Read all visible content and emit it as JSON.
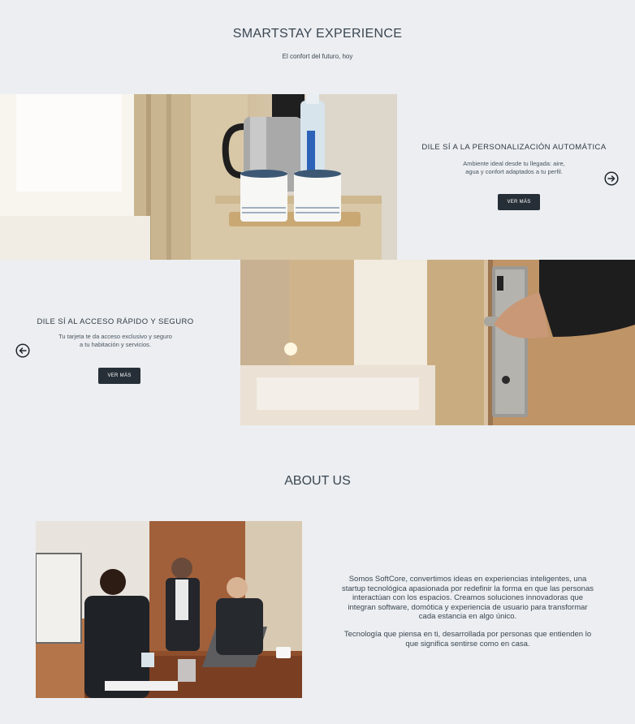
{
  "header": {
    "title": "SMARTSTAY EXPERIENCE",
    "subtitle": "El confort del futuro, hoy"
  },
  "features": [
    {
      "title": "DILE SÍ A LA PERSONALIZACIÓN AUTOMÁTICA",
      "description_lines": [
        "Ambiente ideal desde tu llegada: aire,",
        "agua y confort adaptados a tu perfil."
      ],
      "button_label": "VER MÁS",
      "arrow_icon": "arrow-right-circle-icon"
    },
    {
      "title": "DILE SÍ AL ACCESO RÁPIDO Y SEGURO",
      "description_lines": [
        "Tu tarjeta te da acceso exclusivo y seguro",
        "a tu habitación y servicios."
      ],
      "button_label": "VER MÁS",
      "arrow_icon": "arrow-left-circle-icon"
    }
  ],
  "about": {
    "title": "ABOUT US",
    "paragraph1_lines": [
      "Somos SoftCore, convertimos ideas en experiencias inteligentes, una",
      "startup tecnológica apasionada por redefinir la forma en que las personas",
      "interactúan con los espacios. Creamos soluciones innovadoras que",
      "integran software, domótica y experiencia de usuario para transformar",
      "cada estancia en algo único."
    ],
    "paragraph2_lines": [
      "Tecnología que piensa en ti, desarrollada por personas que entienden lo",
      "que significa sentirse como en casa."
    ]
  },
  "colors": {
    "background": "#eceef1",
    "button": "#262f37",
    "text": "#2f3a45"
  }
}
